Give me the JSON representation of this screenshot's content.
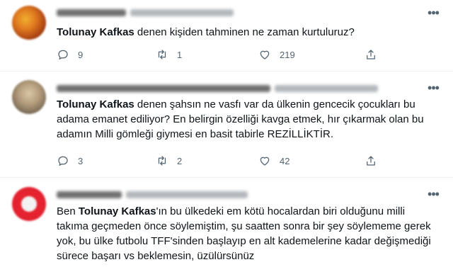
{
  "tweets": [
    {
      "text_bold": "Tolunay Kafkas",
      "text_rest": " denen kişiden tahminen ne zaman kurtuluruz?",
      "replies": "9",
      "retweets": "1",
      "likes": "219"
    },
    {
      "text_bold": "Tolunay Kafkas",
      "text_rest": " denen şahsın ne vasfı var da ülkenin gencecik çocukları bu adama emanet ediliyor? En belirgin özelliği kavga etmek, hır çıkarmak olan bu adamın Milli gömleği giymesi en basit tabirle REZİLLİKTİR.",
      "replies": "3",
      "retweets": "2",
      "likes": "42"
    },
    {
      "text_pre": "Ben ",
      "text_bold": "Tolunay Kafkas",
      "text_rest": "'ın bu ülkedeki em kötü hocalardan biri olduğunu milli takıma geçmeden önce söylemiştim, şu saatten sonra bir şey söylememe gerek yok, bu ülke futbolu TFF'sinden başlayıp en alt kademelerine kadar değişmediği sürece başarı vs beklemesin, üzülürsünüz"
    }
  ],
  "icons": {
    "more": "more-options-icon",
    "reply": "reply-icon",
    "retweet": "retweet-icon",
    "like": "like-icon",
    "share": "share-icon"
  }
}
